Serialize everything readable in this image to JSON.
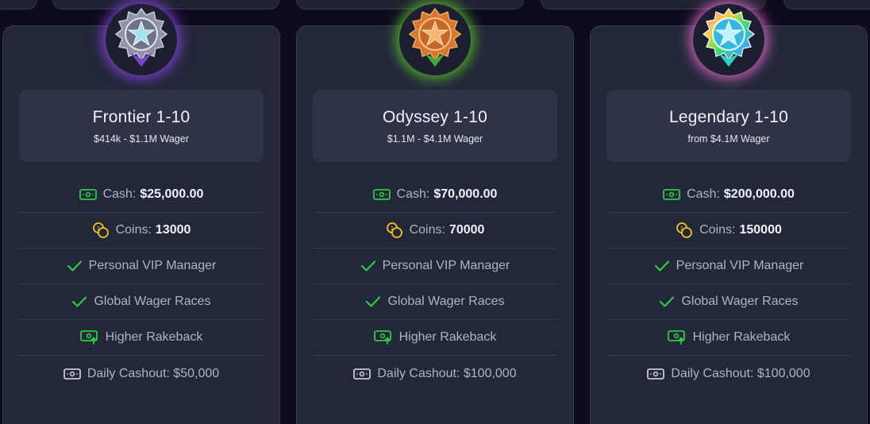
{
  "tiers": [
    {
      "name": "Frontier 1-10",
      "wager": "$414k - $1.1M Wager",
      "cash_label": "Cash:",
      "cash_value": "$25,000.00",
      "coins_label": "Coins:",
      "coins_value": "13000",
      "perk_vip": "Personal VIP Manager",
      "perk_races": "Global Wager Races",
      "perk_rakeback": "Higher Rakeback",
      "daily_cashout": "Daily Cashout: $50,000"
    },
    {
      "name": "Odyssey 1-10",
      "wager": "$1.1M - $4.1M Wager",
      "cash_label": "Cash:",
      "cash_value": "$70,000.00",
      "coins_label": "Coins:",
      "coins_value": "70000",
      "perk_vip": "Personal VIP Manager",
      "perk_races": "Global Wager Races",
      "perk_rakeback": "Higher Rakeback",
      "daily_cashout": "Daily Cashout: $100,000"
    },
    {
      "name": "Legendary 1-10",
      "wager": "from $4.1M Wager",
      "cash_label": "Cash:",
      "cash_value": "$200,000.00",
      "coins_label": "Coins:",
      "coins_value": "150000",
      "perk_vip": "Personal VIP Manager",
      "perk_races": "Global Wager Races",
      "perk_rakeback": "Higher Rakeback",
      "daily_cashout": "Daily Cashout: $100,000"
    }
  ],
  "icons": {
    "cash": "cash-note-icon",
    "coins": "coins-icon",
    "check": "check-icon",
    "rakeback": "rakeback-icon",
    "cashout": "cashout-note-icon"
  },
  "colors": {
    "page_bg": "#0e0b1e",
    "card_bg": "#23273a",
    "tier_box_bg": "#2e3347",
    "green": "#2ecc40",
    "gold": "#f0c419",
    "muted_text": "#aeb3c5",
    "bright_text": "#f1f2f6",
    "glow_frontier": "#8c46e6",
    "glow_odyssey": "#5fc828",
    "glow_legendary": "#eb6ed2"
  }
}
